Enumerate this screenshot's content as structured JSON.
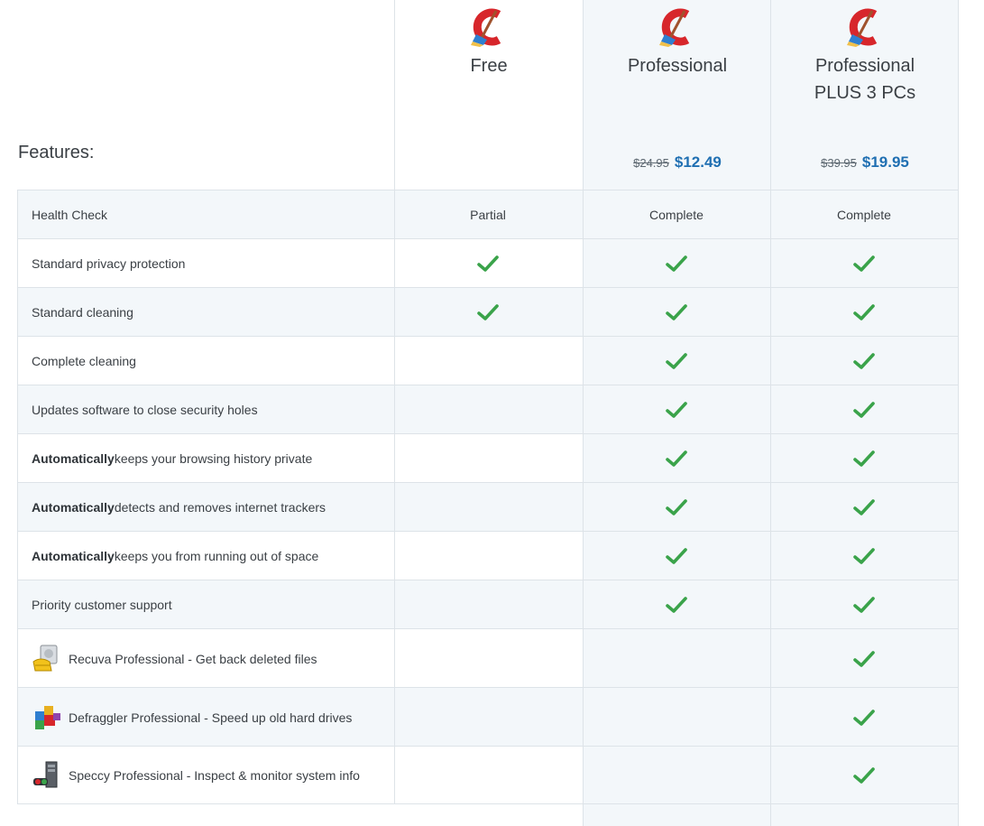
{
  "header": {
    "features_title": "Features:",
    "plans": [
      {
        "name": "Free",
        "old_price": "",
        "price": ""
      },
      {
        "name": "Professional",
        "old_price": "$24.95",
        "price": "$12.49"
      },
      {
        "name": "Professional PLUS 3 PCs",
        "old_price": "$39.95",
        "price": "$19.95"
      }
    ]
  },
  "colors": {
    "accent": "#1f6fb2",
    "check": "#3aa34a",
    "alt_row": "#f3f7fa",
    "border": "#dde3e8"
  },
  "rows": [
    {
      "bold": "",
      "label": "Health Check",
      "free": "Partial",
      "pro": "Complete",
      "plus": "Complete",
      "icon": ""
    },
    {
      "bold": "",
      "label": "Standard privacy protection",
      "free": "check",
      "pro": "check",
      "plus": "check",
      "icon": ""
    },
    {
      "bold": "",
      "label": "Standard cleaning",
      "free": "check",
      "pro": "check",
      "plus": "check",
      "icon": ""
    },
    {
      "bold": "",
      "label": "Complete cleaning",
      "free": "",
      "pro": "check",
      "plus": "check",
      "icon": ""
    },
    {
      "bold": "",
      "label": "Updates software to close security holes",
      "free": "",
      "pro": "check",
      "plus": "check",
      "icon": ""
    },
    {
      "bold": "Automatically",
      "label": " keeps your browsing history private",
      "free": "",
      "pro": "check",
      "plus": "check",
      "icon": ""
    },
    {
      "bold": "Automatically",
      "label": " detects and removes internet trackers",
      "free": "",
      "pro": "check",
      "plus": "check",
      "icon": ""
    },
    {
      "bold": "Automatically",
      "label": " keeps you from running out of space",
      "free": "",
      "pro": "check",
      "plus": "check",
      "icon": ""
    },
    {
      "bold": "",
      "label": "Priority customer support",
      "free": "",
      "pro": "check",
      "plus": "check",
      "icon": ""
    },
    {
      "bold": "",
      "label": "Recuva Professional - Get back deleted files",
      "free": "",
      "pro": "",
      "plus": "check",
      "icon": "recuva-icon"
    },
    {
      "bold": "",
      "label": "Defraggler Professional - Speed up old hard drives",
      "free": "",
      "pro": "",
      "plus": "check",
      "icon": "defraggler-icon"
    },
    {
      "bold": "",
      "label": "Speccy Professional - Inspect & monitor system info",
      "free": "",
      "pro": "",
      "plus": "check",
      "icon": "speccy-icon"
    }
  ]
}
